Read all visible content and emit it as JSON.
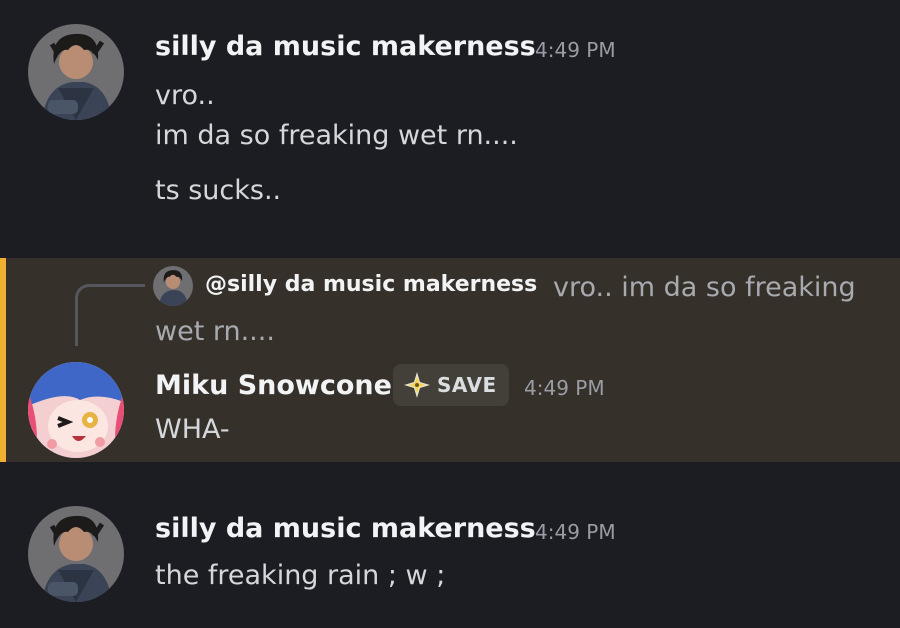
{
  "messages": [
    {
      "author": "silly da music makerness",
      "time": "4:49 PM",
      "lines": [
        "vro..",
        "im da so freaking wet rn....",
        "ts sucks.."
      ]
    },
    {
      "reply_to": {
        "mention": "@silly da music makerness",
        "preview": "vro.. im da so freaking wet rn...."
      },
      "author": "Miku Snowcone",
      "tag": "SAVE",
      "time": "4:49 PM",
      "lines": [
        "WHA-"
      ]
    },
    {
      "author": "silly da music makerness",
      "time": "4:49 PM",
      "lines": [
        "the freaking rain ; w ;"
      ]
    }
  ],
  "colors": {
    "background": "#1c1d22",
    "mention_highlight": "#35302a",
    "mention_bar": "#f0b132",
    "tag_icon": "#f6d44b"
  },
  "icons": {
    "avatar_silly": "user-avatar-dark-hair",
    "avatar_miku": "user-avatar-blue-hair",
    "tag_icon": "sparkle-diamond-icon"
  }
}
